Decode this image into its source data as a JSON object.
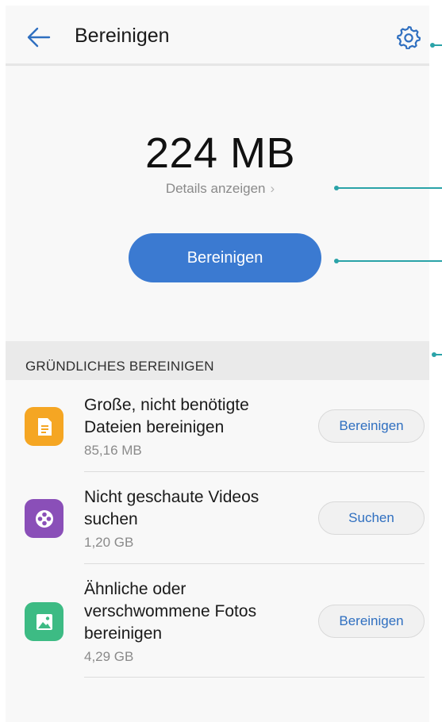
{
  "header": {
    "title": "Bereinigen",
    "back_icon": "arrow-left-icon",
    "settings_icon": "gear-icon"
  },
  "summary": {
    "size": "224 MB",
    "details_label": "Details anzeigen",
    "clean_label": "Bereinigen"
  },
  "section": {
    "title": "GRÜNDLICHES BEREINIGEN"
  },
  "items": [
    {
      "line1": "Große, nicht benötigte",
      "line2": "Dateien bereinigen",
      "line3": "",
      "size": "85,16 MB",
      "action": "Bereinigen",
      "icon": "document-icon",
      "color": "#f5a623"
    },
    {
      "line1": "Nicht geschaute Videos",
      "line2": "suchen",
      "line3": "",
      "size": "1,20 GB",
      "action": "Suchen",
      "icon": "film-reel-icon",
      "color": "#8a4fb8"
    },
    {
      "line1": "Ähnliche oder",
      "line2": "verschwommene Fotos",
      "line3": "bereinigen",
      "size": "4,29 GB",
      "action": "Bereinigen",
      "icon": "image-icon",
      "color": "#3dbb84"
    }
  ],
  "colors": {
    "accent": "#3b7ad1",
    "callout": "#2aa3a8"
  }
}
